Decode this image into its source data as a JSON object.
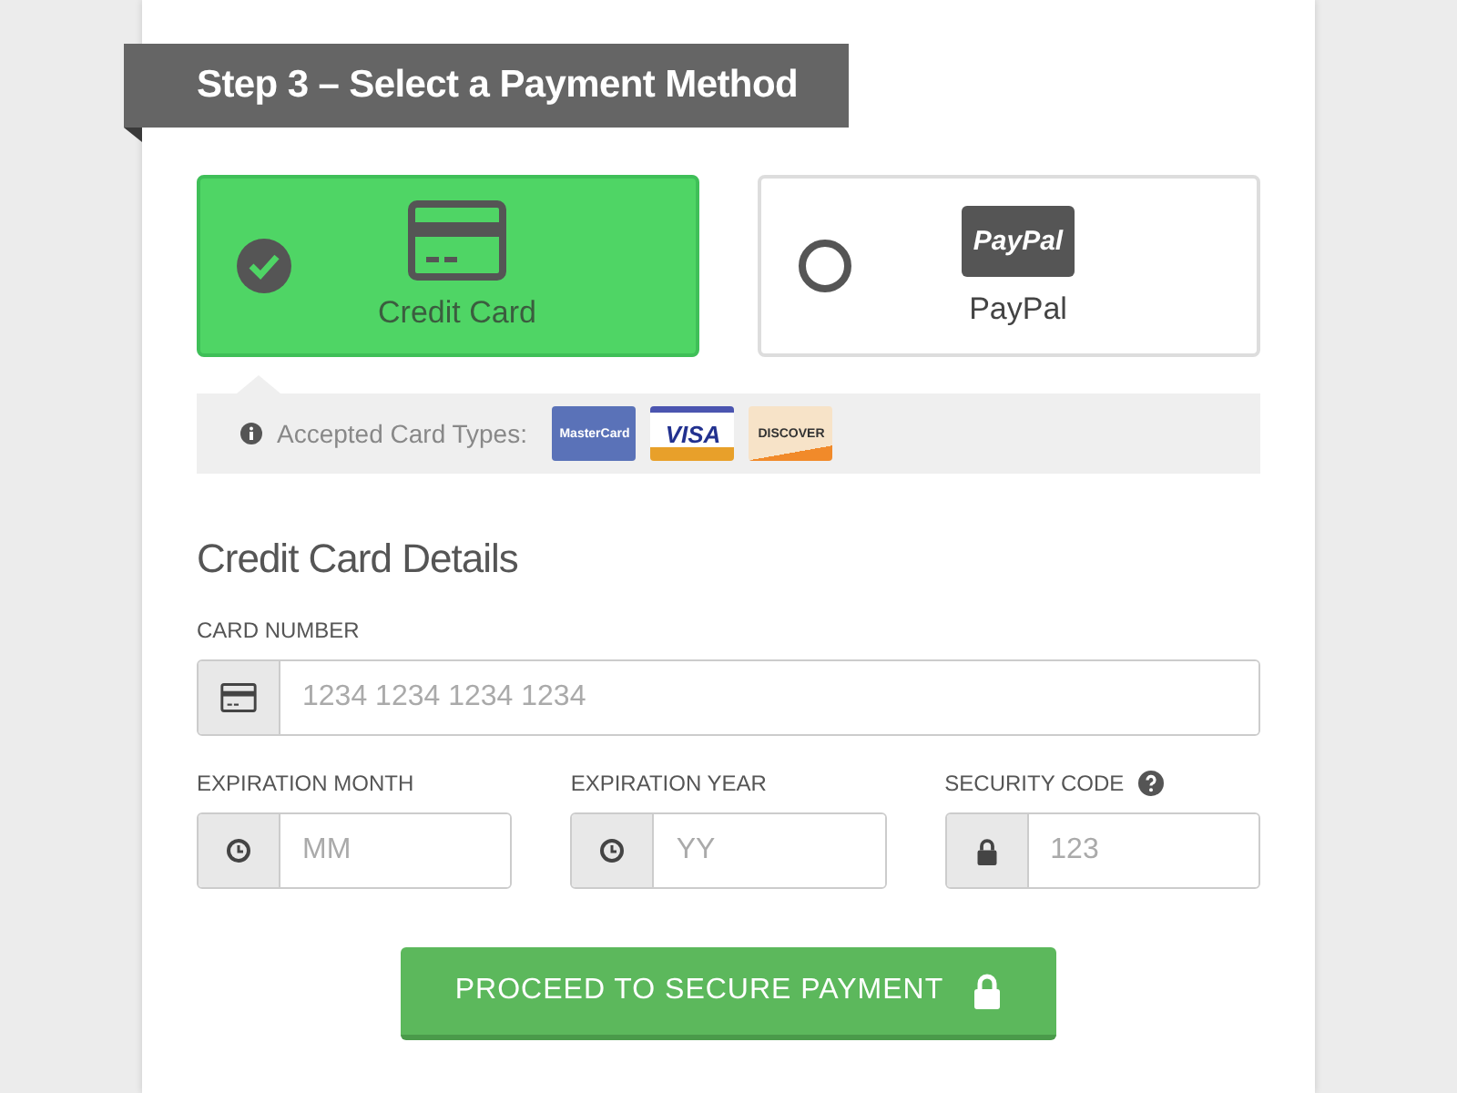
{
  "step_title": "Step 3 – Select a Payment Method",
  "methods": [
    {
      "kind": "card",
      "label": "Credit Card",
      "selected": true
    },
    {
      "kind": "paypal",
      "label": "PayPal",
      "logo": "PayPal",
      "selected": false
    }
  ],
  "accepted": {
    "label": "Accepted Card Types:",
    "cards": [
      {
        "kind": "mastercard",
        "label": "MasterCard"
      },
      {
        "kind": "visa",
        "label": "VISA"
      },
      {
        "kind": "discover",
        "label": "DISCOVER"
      }
    ]
  },
  "details_title": "Credit Card Details",
  "fields": [
    {
      "kind": "card",
      "label": "CARD NUMBER",
      "placeholder": "1234 1234 1234 1234",
      "help": false
    },
    {
      "kind": "clock",
      "label": "EXPIRATION MONTH",
      "placeholder": "MM",
      "help": false
    },
    {
      "kind": "clock",
      "label": "EXPIRATION YEAR",
      "placeholder": "YY",
      "help": false
    },
    {
      "kind": "lock",
      "label": "SECURITY CODE",
      "placeholder": "123",
      "help": true
    }
  ],
  "submit": "PROCEED TO SECURE PAYMENT"
}
